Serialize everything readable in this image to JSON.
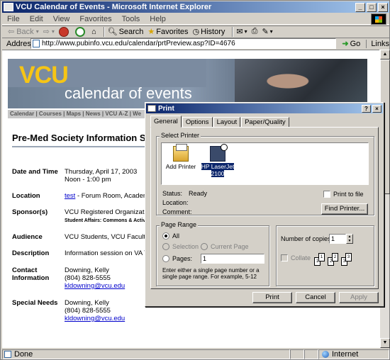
{
  "window": {
    "title": "VCU Calendar of Events - Microsoft Internet Explorer",
    "minimize": "_",
    "maximize": "□",
    "close": "×"
  },
  "menu": [
    "File",
    "Edit",
    "View",
    "Favorites",
    "Tools",
    "Help"
  ],
  "toolbar": {
    "back": "Back",
    "search": "Search",
    "favorites": "Favorites",
    "history": "History"
  },
  "address": {
    "label": "Address",
    "url": "http://www.pubinfo.vcu.edu/calendar/prtPreview.asp?ID=4676",
    "go": "Go",
    "links": "Links"
  },
  "status": {
    "text": "Done",
    "zone": "Internet"
  },
  "page": {
    "banner_logo": "VCU",
    "banner_subtitle": "calendar of events",
    "nav": "Calendar | Courses | Maps | News | VCU A-Z | We",
    "event_title": "Pre-Med Society Information Sess",
    "rows": [
      {
        "label": "Date and Time",
        "lines": [
          "Thursday, April 17, 2003",
          "Noon - 1:00 pm"
        ]
      },
      {
        "label": "Location",
        "link": "test",
        "rest": " - Forum Room,   Academ"
      },
      {
        "label": "Sponsor(s)",
        "lines": [
          "VCU Registered Organization"
        ],
        "note": "Student Affairs: Commons & Activiti"
      },
      {
        "label": "Audience",
        "lines": [
          "VCU Students, VCU Faculty"
        ]
      },
      {
        "label": "Description",
        "lines": [
          "Information session on VA Te"
        ]
      },
      {
        "label": "Contact Information",
        "lines": [
          "Downing, Kelly",
          "(804) 828-5555"
        ],
        "email": "kldowning@vcu.edu"
      },
      {
        "label": "Special Needs",
        "lines": [
          "Downing, Kelly",
          "(804) 828-5555"
        ],
        "email": "kldowning@vcu.edu"
      }
    ]
  },
  "dialog": {
    "title": "Print",
    "help": "?",
    "close": "×",
    "tabs": [
      "General",
      "Options",
      "Layout",
      "Paper/Quality"
    ],
    "select_printer_group": "Select Printer",
    "printers": [
      {
        "name": "Add Printer",
        "icon": "add-printer-icon"
      },
      {
        "name": "HP LaserJet 2100",
        "icon": "printer-icon",
        "selected": true
      }
    ],
    "status_label": "Status:",
    "status_value": "Ready",
    "location_label": "Location:",
    "comment_label": "Comment:",
    "print_to_file": "Print to file",
    "find_printer": "Find Printer...",
    "page_range_group": "Page Range",
    "range_all": "All",
    "range_selection": "Selection",
    "range_current": "Current Page",
    "range_pages": "Pages:",
    "pages_value": "1",
    "range_hint": "Enter either a single page number or a single page range.  For example, 5-12",
    "copies_label": "Number of copies:",
    "copies_value": "1",
    "collate": "Collate",
    "buttons": {
      "print": "Print",
      "cancel": "Cancel",
      "apply": "Apply"
    }
  }
}
